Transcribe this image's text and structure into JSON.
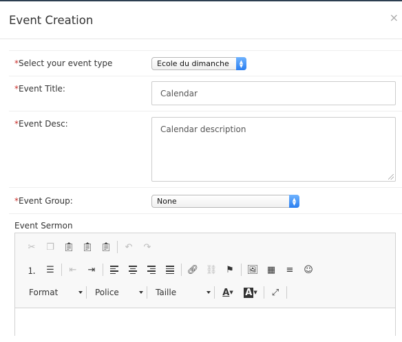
{
  "modal": {
    "title": "Event Creation",
    "close_glyph": "×"
  },
  "fields": {
    "event_type": {
      "required_mark": "*",
      "label": "Select your event type",
      "value": "Ecole du dimanche"
    },
    "event_title": {
      "required_mark": "*",
      "label": "Event Title:",
      "value": "Calendar"
    },
    "event_desc": {
      "required_mark": "*",
      "label": "Event Desc:",
      "value": "Calendar description"
    },
    "event_group": {
      "required_mark": "*",
      "label": "Event Group:",
      "value": "None"
    },
    "event_sermon": {
      "label": "Event Sermon"
    }
  },
  "editor": {
    "row1_icons": [
      "cut-icon",
      "copy-icon",
      "paste-icon",
      "paste-text-icon",
      "paste-word-icon",
      "undo-icon",
      "redo-icon"
    ],
    "row2_icons": [
      "numbered-list-icon",
      "bulleted-list-icon",
      "outdent-icon",
      "indent-icon",
      "align-left-icon",
      "align-center-icon",
      "align-right-icon",
      "justify-icon",
      "link-icon",
      "unlink-icon",
      "anchor-icon",
      "image-icon",
      "table-icon",
      "horizontal-line-icon",
      "smiley-icon"
    ],
    "combos": {
      "format": "Format",
      "font": "Police",
      "size": "Taille"
    },
    "row3_icons": [
      "text-color-icon",
      "background-color-icon",
      "maximize-icon"
    ]
  }
}
